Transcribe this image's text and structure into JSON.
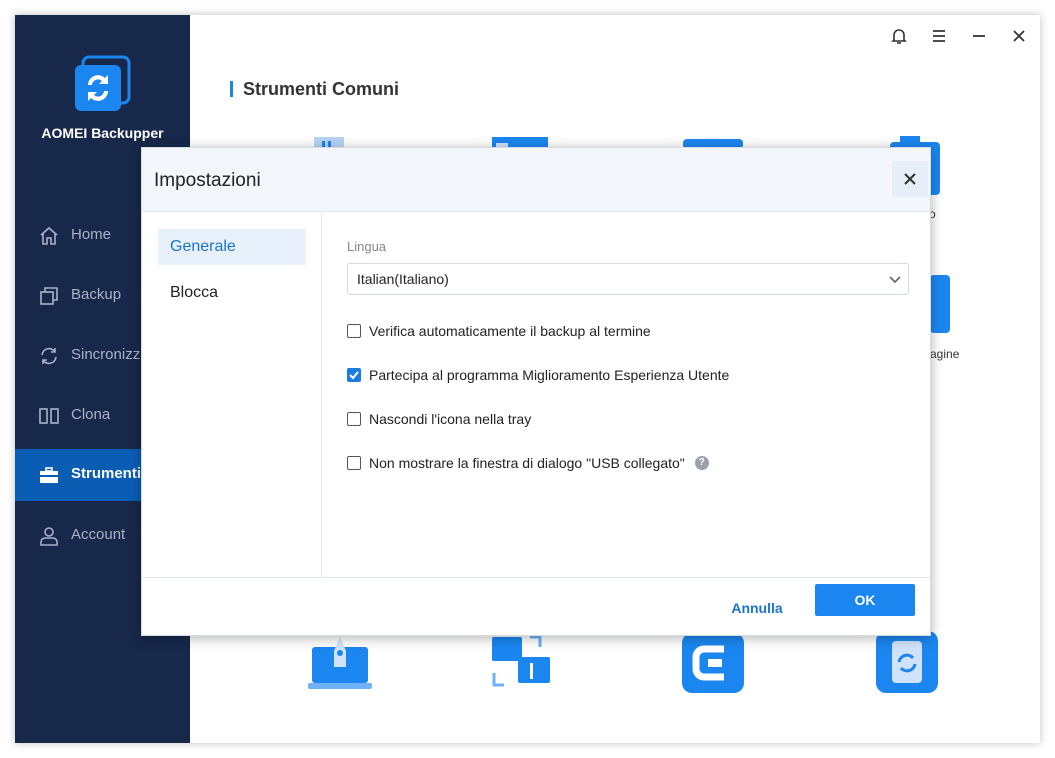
{
  "app": {
    "name": "AOMEI Backupper"
  },
  "sidebar": {
    "items": [
      {
        "label": "Home",
        "icon": "home-icon",
        "active": false
      },
      {
        "label": "Backup",
        "icon": "backup-icon",
        "active": false
      },
      {
        "label": "Sincronizza",
        "icon": "sync-icon",
        "active": false
      },
      {
        "label": "Clona",
        "icon": "clone-icon",
        "active": false
      },
      {
        "label": "Strumenti",
        "icon": "toolbox-icon",
        "active": true
      },
      {
        "label": "Account",
        "icon": "account-icon",
        "active": false
      }
    ]
  },
  "topbar": {
    "icons": [
      "bell-icon",
      "menu-icon",
      "minimize-icon",
      "close-icon"
    ]
  },
  "main": {
    "section_title": "Strumenti Comuni",
    "partial_labels": {
      "r1": "o",
      "r2": "agine"
    }
  },
  "dialog": {
    "title": "Impostazioni",
    "tabs": [
      {
        "label": "Generale",
        "active": true
      },
      {
        "label": "Blocca",
        "active": false
      }
    ],
    "language_label": "Lingua",
    "language_value": "Italian(Italiano)",
    "options": [
      {
        "label": "Verifica automaticamente il backup al termine",
        "checked": false
      },
      {
        "label": "Partecipa al programma Miglioramento Esperienza Utente",
        "checked": true
      },
      {
        "label": "Nascondi l'icona nella tray",
        "checked": false
      },
      {
        "label": "Non mostrare la finestra di dialogo \"USB collegato\"",
        "checked": false,
        "help": "?"
      }
    ],
    "cancel_label": "Annulla",
    "ok_label": "OK"
  },
  "colors": {
    "sidebar": "#17284a",
    "active": "#0b5db4",
    "accent": "#1b86f0"
  }
}
